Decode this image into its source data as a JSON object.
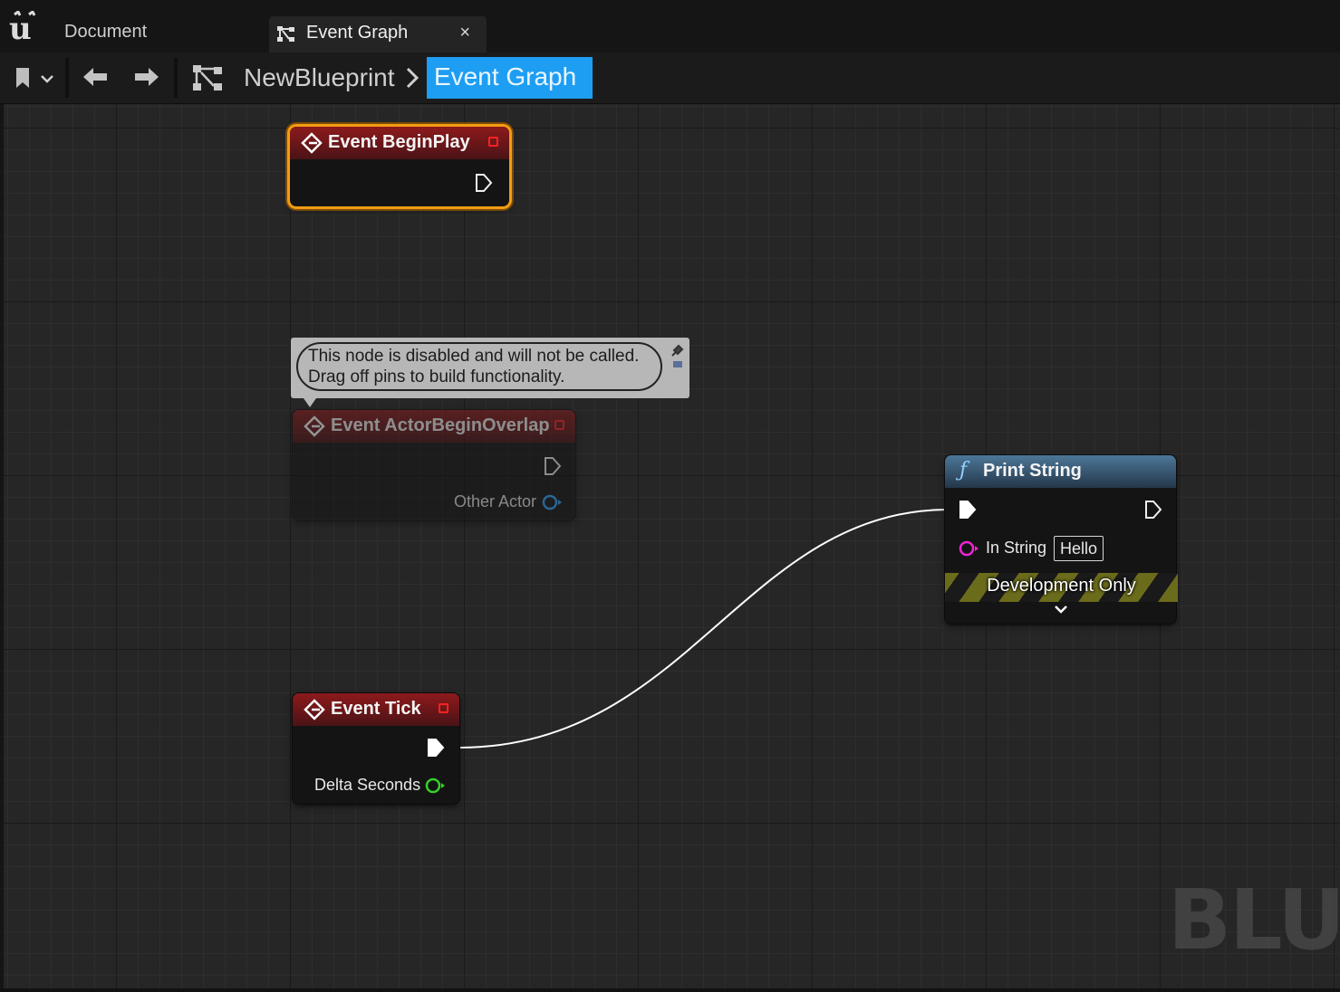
{
  "app": {
    "document_label": "Document",
    "tab": {
      "label": "Event Graph",
      "close_glyph": "×"
    }
  },
  "breadcrumb": {
    "root": "NewBlueprint",
    "current": "Event Graph"
  },
  "colors": {
    "accent": "#1e9ef2",
    "selection": "#f39c11",
    "event_header": "#8d1a1c",
    "function_header": "#4d7798",
    "exec_wire": "#ffffff"
  },
  "nodes": {
    "begin_play": {
      "title": "Event BeginPlay",
      "selected": true
    },
    "actor_overlap": {
      "title": "Event ActorBeginOverlap",
      "disabled": true,
      "pin_other_actor": "Other Actor"
    },
    "tick": {
      "title": "Event Tick",
      "pin_delta": "Delta Seconds"
    },
    "print_string": {
      "title": "Print String",
      "pin_in_string": "In String",
      "in_string_value": "Hello",
      "dev_only": "Development Only"
    }
  },
  "comment": {
    "line1": "This node is disabled and will not be called.",
    "line2": "Drag off pins to build functionality."
  },
  "watermark": "BLU",
  "icons": [
    "unreal-logo-icon",
    "event-graph-icon",
    "close-icon",
    "bookmark-icon",
    "chevron-down-icon",
    "back-arrow-icon",
    "forward-arrow-icon",
    "graph-icon",
    "chevron-right-icon",
    "event-icon",
    "function-icon",
    "exec-pin-icon",
    "pin-icon"
  ]
}
